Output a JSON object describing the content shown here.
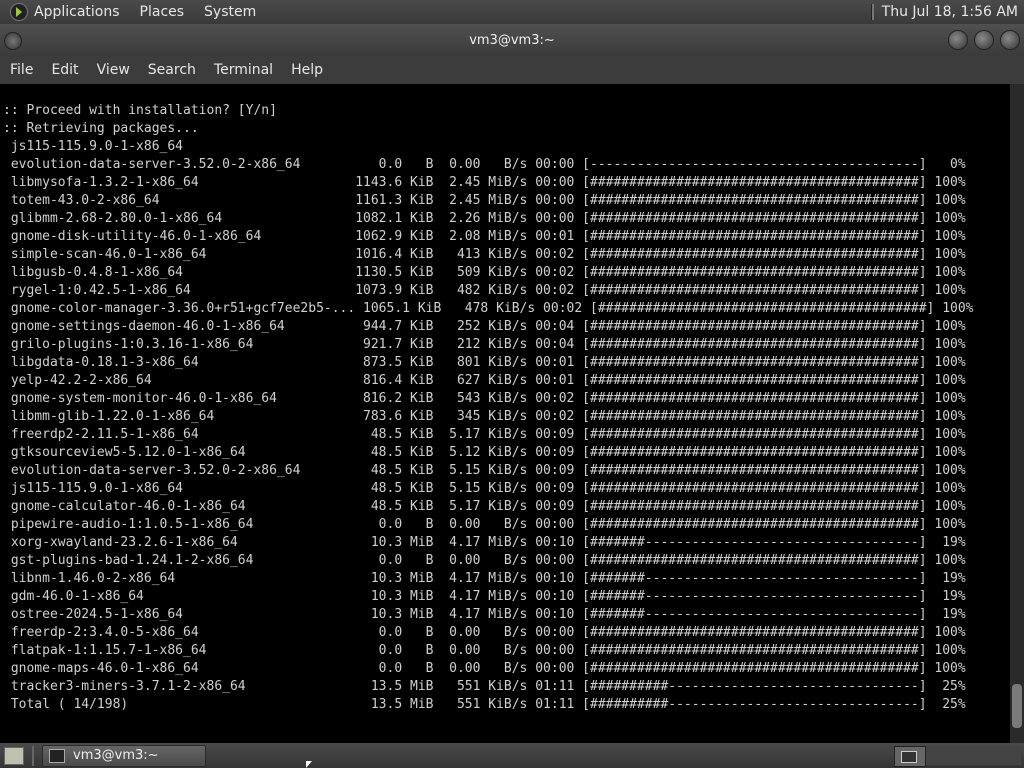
{
  "top_panel": {
    "menus": [
      "Applications",
      "Places",
      "System"
    ],
    "clock": "Thu Jul 18,  1:56 AM"
  },
  "window": {
    "title": "vm3@vm3:~",
    "menus": [
      "File",
      "Edit",
      "View",
      "Search",
      "Terminal",
      "Help"
    ]
  },
  "terminal": {
    "lines": [
      ":: Proceed with installation? [Y/n]",
      ":: Retrieving packages...",
      " js115-115.9.0-1-x86_64",
      " evolution-data-server-3.52.0-2-x86_64          0.0   B  0.00   B/s 00:00 [------------------------------------------]   0%",
      " libmysofa-1.3.2-1-x86_64                    1143.6 KiB  2.45 MiB/s 00:00 [##########################################] 100%",
      " totem-43.0-2-x86_64                         1161.3 KiB  2.45 MiB/s 00:00 [##########################################] 100%",
      " glibmm-2.68-2.80.0-1-x86_64                 1082.1 KiB  2.26 MiB/s 00:00 [##########################################] 100%",
      " gnome-disk-utility-46.0-1-x86_64            1062.9 KiB  2.08 MiB/s 00:01 [##########################################] 100%",
      " simple-scan-46.0-1-x86_64                   1016.4 KiB   413 KiB/s 00:02 [##########################################] 100%",
      " libgusb-0.4.8-1-x86_64                      1130.5 KiB   509 KiB/s 00:02 [##########################################] 100%",
      " rygel-1:0.42.5-1-x86_64                     1073.9 KiB   482 KiB/s 00:02 [##########################################] 100%",
      " gnome-color-manager-3.36.0+r51+gcf7ee2b5-... 1065.1 KiB   478 KiB/s 00:02 [##########################################] 100%",
      " gnome-settings-daemon-46.0-1-x86_64          944.7 KiB   252 KiB/s 00:04 [##########################################] 100%",
      " grilo-plugins-1:0.3.16-1-x86_64              921.7 KiB   212 KiB/s 00:04 [##########################################] 100%",
      " libgdata-0.18.1-3-x86_64                     873.5 KiB   801 KiB/s 00:01 [##########################################] 100%",
      " yelp-42.2-2-x86_64                           816.4 KiB   627 KiB/s 00:01 [##########################################] 100%",
      " gnome-system-monitor-46.0-1-x86_64           816.2 KiB   543 KiB/s 00:02 [##########################################] 100%",
      " libmm-glib-1.22.0-1-x86_64                   783.6 KiB   345 KiB/s 00:02 [##########################################] 100%",
      " freerdp2-2.11.5-1-x86_64                      48.5 KiB  5.17 KiB/s 00:09 [##########################################] 100%",
      " gtksourceview5-5.12.0-1-x86_64                48.5 KiB  5.12 KiB/s 00:09 [##########################################] 100%",
      " evolution-data-server-3.52.0-2-x86_64         48.5 KiB  5.15 KiB/s 00:09 [##########################################] 100%",
      " js115-115.9.0-1-x86_64                        48.5 KiB  5.15 KiB/s 00:09 [##########################################] 100%",
      " gnome-calculator-46.0-1-x86_64                48.5 KiB  5.17 KiB/s 00:09 [##########################################] 100%",
      " pipewire-audio-1:1.0.5-1-x86_64                0.0   B  0.00   B/s 00:00 [##########################################] 100%",
      " xorg-xwayland-23.2.6-1-x86_64                 10.3 MiB  4.17 MiB/s 00:10 [#######-----------------------------------]  19%",
      " gst-plugins-bad-1.24.1-2-x86_64                0.0   B  0.00   B/s 00:00 [##########################################] 100%",
      " libnm-1.46.0-2-x86_64                         10.3 MiB  4.17 MiB/s 00:10 [#######-----------------------------------]  19%",
      " gdm-46.0-1-x86_64                             10.3 MiB  4.17 MiB/s 00:10 [#######-----------------------------------]  19%",
      " ostree-2024.5-1-x86_64                        10.3 MiB  4.17 MiB/s 00:10 [#######-----------------------------------]  19%",
      " freerdp-2:3.4.0-5-x86_64                       0.0   B  0.00   B/s 00:00 [##########################################] 100%",
      " flatpak-1:1.15.7-1-x86_64                      0.0   B  0.00   B/s 00:00 [##########################################] 100%",
      " gnome-maps-46.0-1-x86_64                       0.0   B  0.00   B/s 00:00 [##########################################] 100%",
      " tracker3-miners-3.7.1-2-x86_64                13.5 MiB   551 KiB/s 01:11 [##########--------------------------------]  25%",
      " Total ( 14/198)                               13.5 MiB   551 KiB/s 01:11 [##########--------------------------------]  25%"
    ]
  },
  "taskbar": {
    "task_label": "vm3@vm3:~"
  },
  "icons": {
    "distro": "distro-logo-icon",
    "window_menu": "window-menu-icon",
    "minimize": "minimize-icon",
    "maximize": "maximize-icon",
    "close": "close-icon",
    "show_desktop": "show-desktop-icon",
    "terminal": "terminal-icon"
  }
}
